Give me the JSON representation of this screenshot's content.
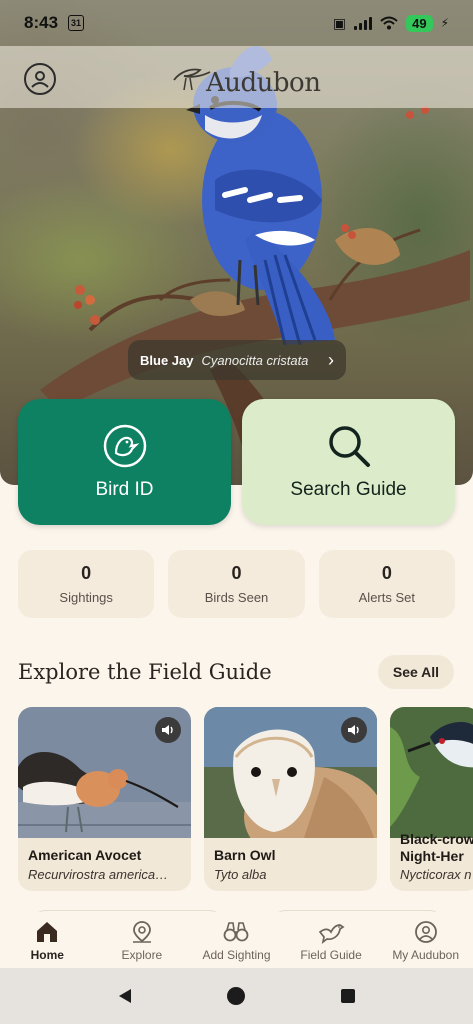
{
  "status_bar": {
    "time": "8:43",
    "calendar_day": "31",
    "battery": "49"
  },
  "header": {
    "logo_text": "Audubon"
  },
  "hero": {
    "common_name": "Blue Jay",
    "scientific_name": "Cyanocitta cristata"
  },
  "actions": {
    "bird_id_label": "Bird ID",
    "search_label": "Search Guide"
  },
  "stats": [
    {
      "value": "0",
      "label": "Sightings"
    },
    {
      "value": "0",
      "label": "Birds Seen"
    },
    {
      "value": "0",
      "label": "Alerts Set"
    }
  ],
  "field_guide": {
    "title": "Explore the Field Guide",
    "see_all": "See All",
    "cards": [
      {
        "name": "American Avocet",
        "scientific": "Recurvirostra america…"
      },
      {
        "name": "Barn Owl",
        "scientific": "Tyto alba"
      },
      {
        "name": "Black-crow Night-Her",
        "scientific": "Nycticorax n"
      }
    ]
  },
  "nav": {
    "items": [
      {
        "label": "Home",
        "icon": "home-icon"
      },
      {
        "label": "Explore",
        "icon": "map-pin-icon"
      },
      {
        "label": "Add Sighting",
        "icon": "binoculars-icon"
      },
      {
        "label": "Field Guide",
        "icon": "bird-icon"
      },
      {
        "label": "My Audubon",
        "icon": "user-icon"
      }
    ]
  },
  "colors": {
    "primary_green": "#0d8162",
    "light_green": "#dcebc9",
    "background": "#fbf5ec",
    "card": "#f2e8d8"
  }
}
